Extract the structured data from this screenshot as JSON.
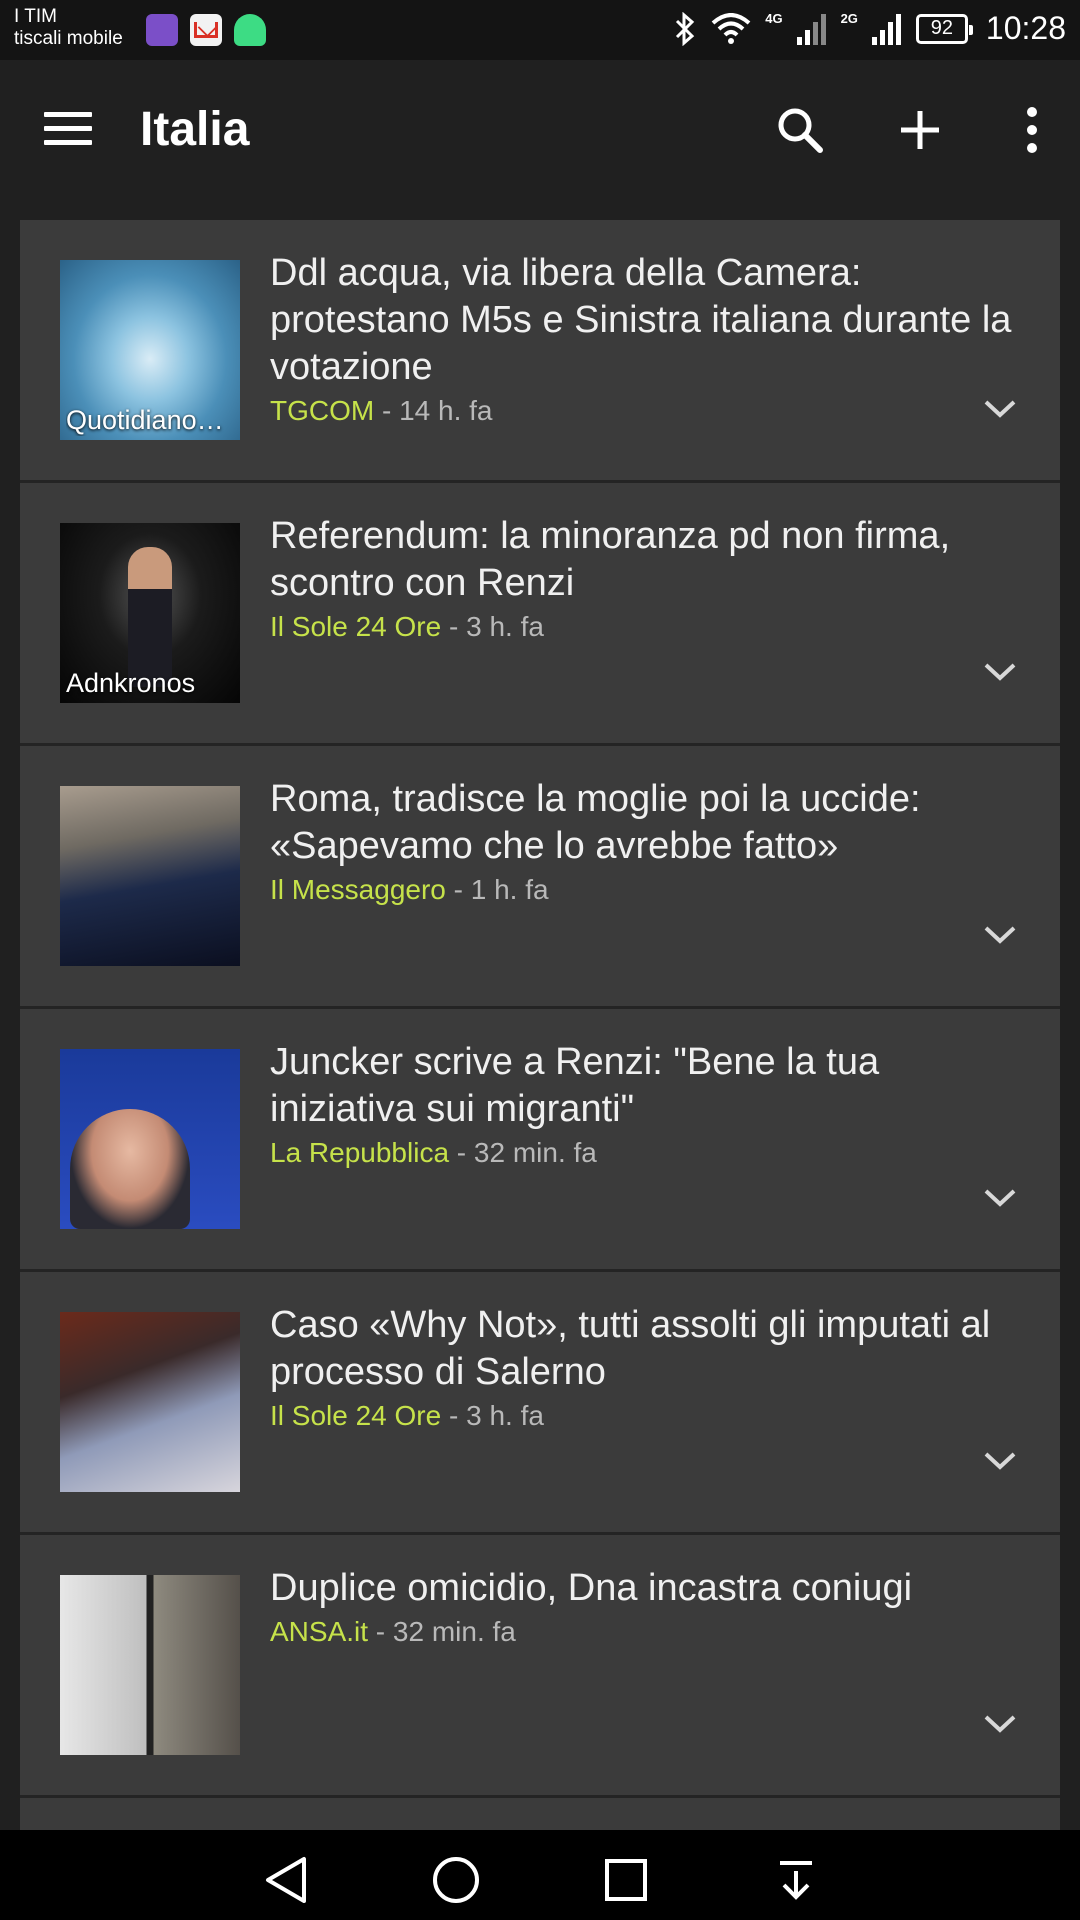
{
  "status_bar": {
    "carrier_line1": "I TIM",
    "carrier_line2": "tiscali mobile",
    "net_4g": "4G",
    "net_2g": "2G",
    "battery": "92",
    "time": "10:28"
  },
  "app_bar": {
    "title": "Italia",
    "icons": [
      "menu-icon",
      "search-icon",
      "add-icon",
      "more-vert-icon"
    ]
  },
  "colors": {
    "background": "#202020",
    "card": "#3b3b3b",
    "source_accent": "#c6e24a",
    "meta_text": "#b9b9b9"
  },
  "articles": [
    {
      "headline": "Ddl acqua, via libera della Camera: protestano M5s e Sinistra italiana durante la votazione",
      "source": "TGCOM",
      "age": " - 14 h. fa",
      "thumb_caption": "Quotidiano…"
    },
    {
      "headline": "Referendum: la minoranza pd non firma, scontro con Renzi",
      "source": "Il Sole 24 Ore",
      "age": " - 3 h. fa",
      "thumb_caption": "Adnkronos"
    },
    {
      "headline": "Roma, tradisce la moglie poi la uccide: «Sapevamo che lo avrebbe fatto»",
      "source": "Il Messaggero",
      "age": " - 1 h. fa",
      "thumb_caption": ""
    },
    {
      "headline": "Juncker scrive a Renzi: \"Bene la tua iniziativa sui migranti\"",
      "source": "La Repubblica",
      "age": " - 32 min. fa",
      "thumb_caption": ""
    },
    {
      "headline": "Caso «Why Not», tutti assolti gli imputati al processo di Salerno",
      "source": "Il Sole 24 Ore",
      "age": " - 3 h. fa",
      "thumb_caption": ""
    },
    {
      "headline": "Duplice omicidio, Dna incastra coniugi",
      "source": "ANSA.it",
      "age": " - 32 min. fa",
      "thumb_caption": ""
    }
  ],
  "nav_bar": {
    "icons": [
      "back-icon",
      "home-icon",
      "recents-icon",
      "notification-pull-icon"
    ]
  }
}
